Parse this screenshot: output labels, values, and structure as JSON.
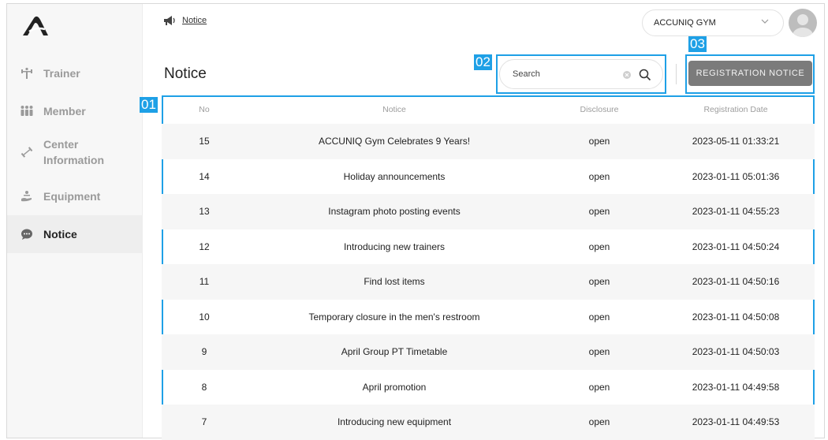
{
  "sidebar": {
    "items": [
      {
        "label": "Trainer",
        "icon": "dumbbell-icon",
        "active": false
      },
      {
        "label": "Member",
        "icon": "members-icon",
        "active": false
      },
      {
        "label": "Center\nInformation",
        "label_line1": "Center",
        "label_line2": "Information",
        "icon": "weight-icon",
        "active": false
      },
      {
        "label": "Equipment",
        "icon": "hand-service-icon",
        "active": false
      },
      {
        "label": "Notice",
        "icon": "chat-bubble-icon",
        "active": true
      }
    ]
  },
  "header": {
    "breadcrumb": "Notice",
    "gym_select_value": "ACCUNIQ GYM"
  },
  "main": {
    "title": "Notice",
    "search_placeholder": "Search",
    "registration_button": "REGISTRATION NOTICE"
  },
  "callouts": {
    "table": "01",
    "search": "02",
    "button": "03"
  },
  "table": {
    "columns": [
      "No",
      "Notice",
      "Disclosure",
      "Registration Date"
    ],
    "rows": [
      {
        "no": "15",
        "notice": "ACCUNIQ Gym Celebrates 9 Years!",
        "disclosure": "open",
        "date": "2023-05-11 01:33:21"
      },
      {
        "no": "14",
        "notice": "Holiday announcements",
        "disclosure": "open",
        "date": "2023-01-11 05:01:36"
      },
      {
        "no": "13",
        "notice": "Instagram photo posting events",
        "disclosure": "open",
        "date": "2023-01-11 04:55:23"
      },
      {
        "no": "12",
        "notice": "Introducing new trainers",
        "disclosure": "open",
        "date": "2023-01-11 04:50:24"
      },
      {
        "no": "11",
        "notice": "Find lost items",
        "disclosure": "open",
        "date": "2023-01-11 04:50:16"
      },
      {
        "no": "10",
        "notice": "Temporary closure in the men's restroom",
        "disclosure": "open",
        "date": "2023-01-11 04:50:08"
      },
      {
        "no": "9",
        "notice": "April Group PT Timetable",
        "disclosure": "open",
        "date": "2023-01-11 04:50:03"
      },
      {
        "no": "8",
        "notice": "April promotion",
        "disclosure": "open",
        "date": "2023-01-11 04:49:58"
      },
      {
        "no": "7",
        "notice": "Introducing new equipment",
        "disclosure": "open",
        "date": "2023-01-11 04:49:53"
      }
    ]
  },
  "colors": {
    "accent": "#1ea0e6",
    "button": "#7b7b7b",
    "row_alt": "#f6f6f6"
  }
}
